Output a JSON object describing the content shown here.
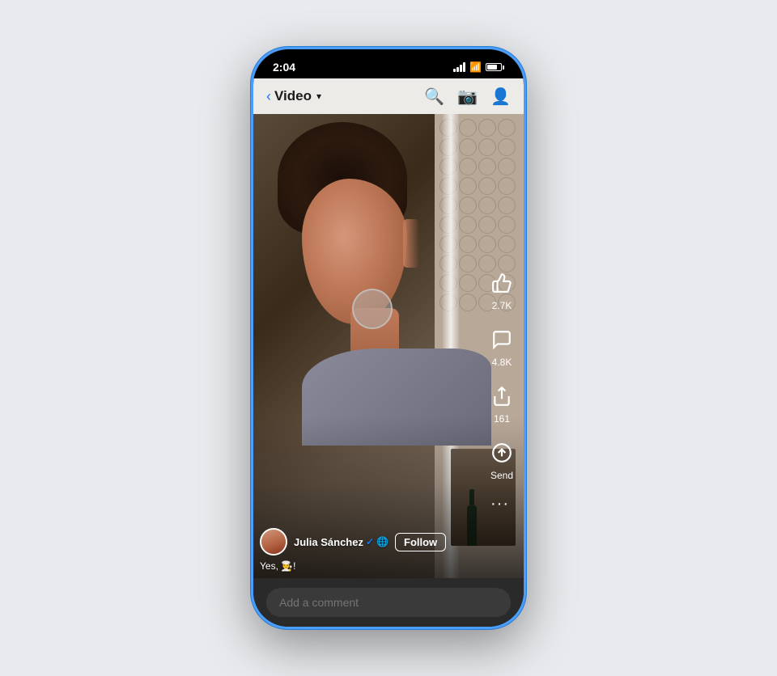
{
  "phone": {
    "status_bar": {
      "time": "2:04",
      "signal_label": "signal",
      "wifi_label": "wifi",
      "battery_label": "battery"
    },
    "nav": {
      "back_label": "Video",
      "dropdown_arrow": "▾",
      "search_icon": "search",
      "camera_icon": "camera",
      "profile_icon": "profile"
    },
    "actions": {
      "like_count": "2.7K",
      "comment_count": "4.8K",
      "share_count": "161",
      "send_label": "Send",
      "more_dots": "···"
    },
    "user": {
      "name": "Julia Sánchez",
      "verified": "✓",
      "follow_label": "Follow",
      "caption": "Yes, 🧑‍🍳!"
    },
    "comment_bar": {
      "placeholder": "Add a comment"
    }
  }
}
